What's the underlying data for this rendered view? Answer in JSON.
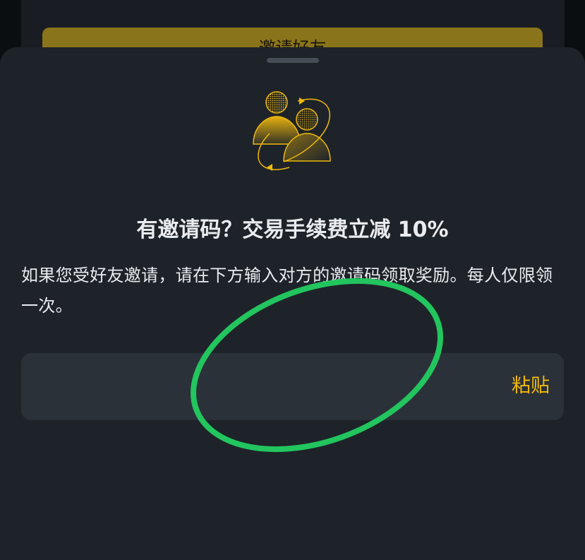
{
  "background": {
    "invite_button_label": "邀请好友"
  },
  "sheet": {
    "illustration_icon": "invite-friends-icon",
    "title": "有邀请码？交易手续费立减 10%",
    "description": "如果您受好友邀请，请在下方输入对方的邀请码领取奖励。每人仅限领一次。",
    "code_input": {
      "value": "",
      "placeholder": ""
    },
    "paste_label": "粘贴"
  },
  "annotation": {
    "shape": "ellipse",
    "color": "#22c55e"
  },
  "colors": {
    "accent": "#f0b90b",
    "sheet_bg": "#1e2329",
    "field_bg": "#2b3139",
    "text_primary": "#eaecef"
  }
}
